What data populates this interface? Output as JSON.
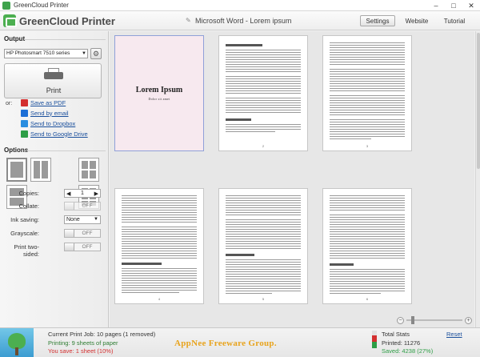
{
  "window": {
    "title": "GreenCloud Printer"
  },
  "header": {
    "app_name": "GreenCloud Printer",
    "document_title": "Microsoft Word - Lorem ipsum",
    "nav": {
      "settings": "Settings",
      "website": "Website",
      "tutorial": "Tutorial"
    }
  },
  "sidebar": {
    "output_heading": "Output",
    "printer": "HP Photosmart 7510 series",
    "print_label": "Print",
    "or_label": "or:",
    "alternatives": [
      {
        "label": "Save as PDF",
        "icon": "pdf-icon",
        "color": "#d32f2f"
      },
      {
        "label": "Send by email",
        "icon": "email-icon",
        "color": "#1e6fd6"
      },
      {
        "label": "Send to Dropbox",
        "icon": "dropbox-icon",
        "color": "#2a8de0"
      },
      {
        "label": "Send to Google Drive",
        "icon": "google-drive-icon",
        "color": "#2e9e46"
      }
    ],
    "options_heading": "Options",
    "options": {
      "copies_label": "Copies:",
      "copies_value": "1",
      "collate_label": "Collate:",
      "collate_value": "OFF",
      "ink_label": "Ink saving:",
      "ink_value": "None",
      "grayscale_label": "Grayscale:",
      "grayscale_value": "OFF",
      "two_sided_label": "Print two-sided:",
      "two_sided_value": "OFF"
    }
  },
  "preview": {
    "first_page_title": "Lorem Ipsum",
    "first_page_subtitle": "Dolor sit amet",
    "page_count_shown": 6
  },
  "status": {
    "current_job": "Current Print Job: 10 pages (1 removed)",
    "printing": "Printing: 9 sheets of paper",
    "you_save": "You save: 1 sheet (10%)",
    "total_stats_label": "Total Stats",
    "printed": "Printed: 11276",
    "saved": "Saved: 4238 (27%)",
    "reset": "Reset",
    "watermark": "AppNee Freeware Group."
  },
  "colors": {
    "accent_green": "#4caf50",
    "link_blue": "#1a4f9c",
    "save_red": "#d32f2f",
    "saved_green": "#2e9e46"
  }
}
